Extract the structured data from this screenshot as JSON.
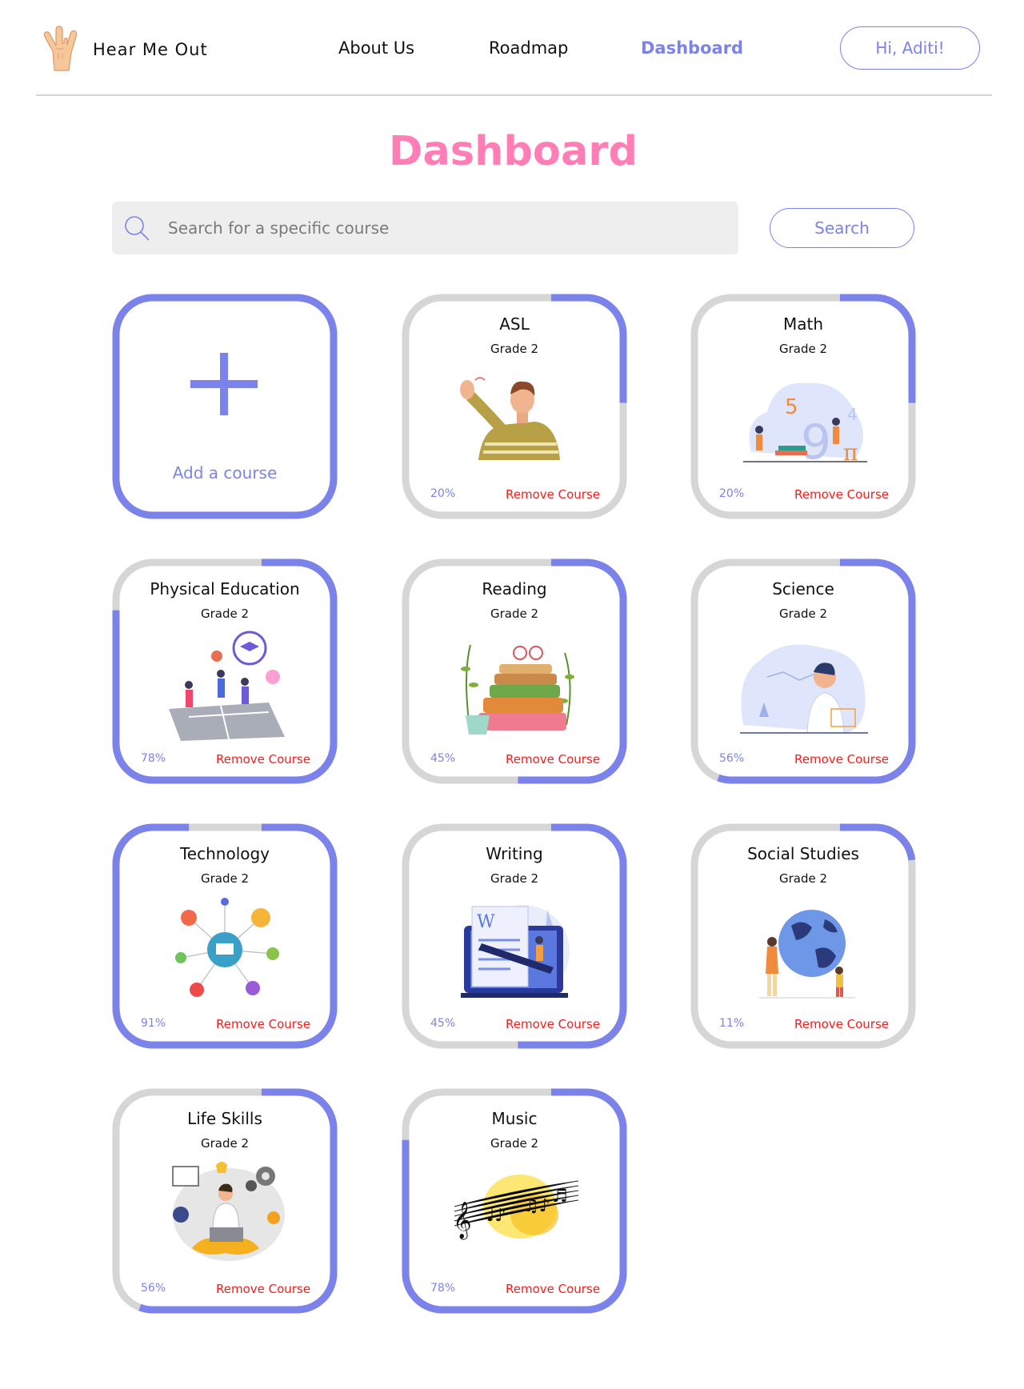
{
  "header": {
    "brand": "Hear Me Out",
    "nav": [
      "About Us",
      "Roadmap",
      "Dashboard"
    ],
    "active_nav": "Dashboard",
    "user_greeting": "Hi, Aditi!"
  },
  "page": {
    "title": "Dashboard"
  },
  "search": {
    "placeholder": "Search for a specific course",
    "value": "",
    "button_label": "Search"
  },
  "add_card": {
    "label": "Add a course"
  },
  "remove_label": "Remove Course",
  "colors": {
    "accent": "#7b83eb",
    "title_pink": "#ff7eb6",
    "remove_red": "#ff1a1a",
    "track_gray": "#d6d6d6"
  },
  "courses": [
    {
      "title": "ASL",
      "grade": "Grade 2",
      "progress": 0.2,
      "progress_label": "20%",
      "icon": "sign-language-teacher-illustration"
    },
    {
      "title": "Math",
      "grade": "Grade 2",
      "progress": 0.2,
      "progress_label": "20%",
      "icon": "math-numbers-illustration"
    },
    {
      "title": "Physical Education",
      "grade": "Grade 2",
      "progress": 0.78,
      "progress_label": "78%",
      "icon": "sports-field-illustration"
    },
    {
      "title": "Reading",
      "grade": "Grade 2",
      "progress": 0.45,
      "progress_label": "45%",
      "icon": "book-stack-illustration"
    },
    {
      "title": "Science",
      "grade": "Grade 2",
      "progress": 0.56,
      "progress_label": "56%",
      "icon": "scientist-lab-illustration"
    },
    {
      "title": "Technology",
      "grade": "Grade 2",
      "progress": 0.91,
      "progress_label": "91%",
      "icon": "tech-network-illustration"
    },
    {
      "title": "Writing",
      "grade": "Grade 2",
      "progress": 0.45,
      "progress_label": "45%",
      "icon": "document-pencil-illustration"
    },
    {
      "title": "Social Studies",
      "grade": "Grade 2",
      "progress": 0.11,
      "progress_label": "11%",
      "icon": "globe-people-illustration"
    },
    {
      "title": "Life Skills",
      "grade": "Grade 2",
      "progress": 0.56,
      "progress_label": "56%",
      "icon": "person-laptop-illustration"
    },
    {
      "title": "Music",
      "grade": "Grade 2",
      "progress": 0.78,
      "progress_label": "78%",
      "icon": "music-notes-illustration"
    }
  ]
}
